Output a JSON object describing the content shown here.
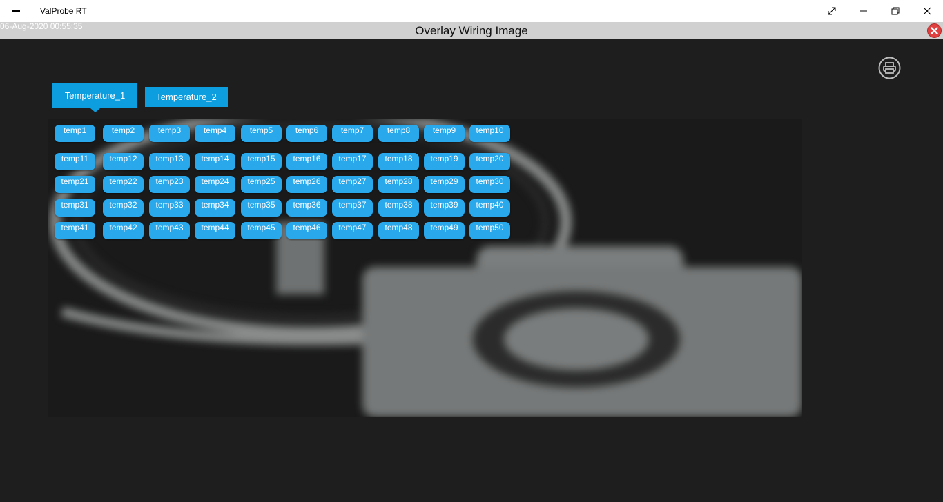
{
  "app": {
    "title": "ValProbe RT"
  },
  "window": {
    "icons": [
      "menu-icon",
      "expand-icon",
      "minimize-icon",
      "restore-icon",
      "close-icon"
    ]
  },
  "header": {
    "timestamp": "06-Aug-2020 00:55:35",
    "title": "Overlay Wiring Image",
    "close_icon": "close-circle-icon",
    "close_color": "#e0403f"
  },
  "toolbar": {
    "print_icon": "printer-icon"
  },
  "tabs": [
    {
      "label": "Temperature_1",
      "selected": true
    },
    {
      "label": "Temperature_2",
      "selected": false
    }
  ],
  "colors": {
    "accent": "#0d9ee0",
    "button": "#29a8ec",
    "background": "#1e1e1e",
    "header": "#cfd0cf"
  },
  "image": {
    "placeholder_icon": "camera-icon"
  },
  "sensors": [
    "temp1",
    "temp2",
    "temp3",
    "temp4",
    "temp5",
    "temp6",
    "temp7",
    "temp8",
    "temp9",
    "temp10",
    "temp11",
    "temp12",
    "temp13",
    "temp14",
    "temp15",
    "temp16",
    "temp17",
    "temp18",
    "temp19",
    "temp20",
    "temp21",
    "temp22",
    "temp23",
    "temp24",
    "temp25",
    "temp26",
    "temp27",
    "temp28",
    "temp29",
    "temp30",
    "temp31",
    "temp32",
    "temp33",
    "temp34",
    "temp35",
    "temp36",
    "temp37",
    "temp38",
    "temp39",
    "temp40",
    "temp41",
    "temp42",
    "temp43",
    "temp44",
    "temp45",
    "temp46",
    "temp47",
    "temp48",
    "temp49",
    "temp50"
  ]
}
